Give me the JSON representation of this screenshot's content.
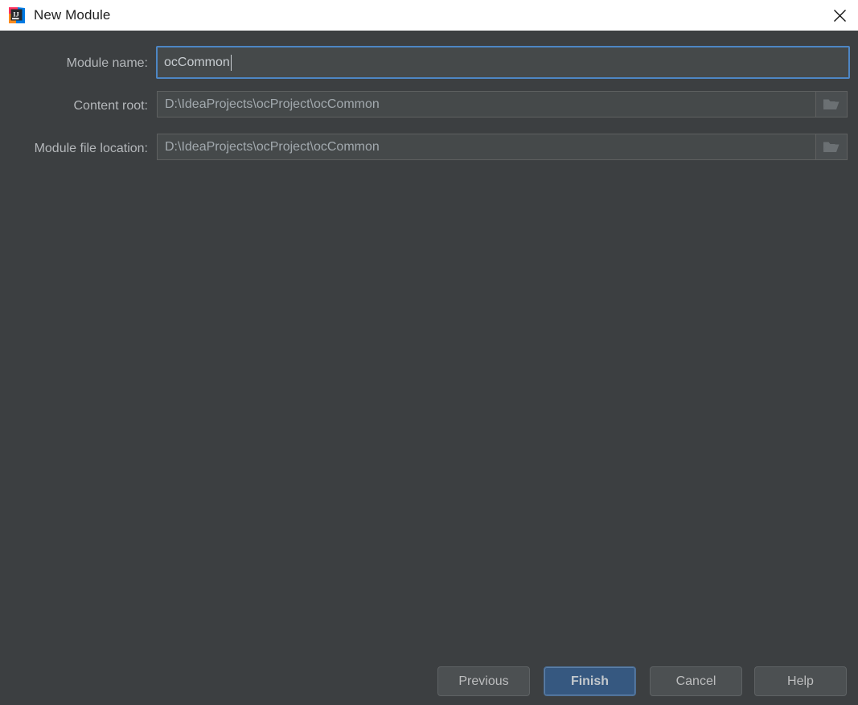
{
  "window": {
    "title": "New Module",
    "logo_icon": "intellij-idea-logo-icon",
    "close_icon": "close-icon"
  },
  "form": {
    "fields": [
      {
        "label": "Module name:",
        "value": "ocCommon",
        "focused": true,
        "has_browse": false
      },
      {
        "label": "Content root:",
        "value": "D:\\IdeaProjects\\ocProject\\ocCommon",
        "focused": false,
        "has_browse": true,
        "browse_icon": "folder-icon"
      },
      {
        "label": "Module file location:",
        "value": "D:\\IdeaProjects\\ocProject\\ocCommon",
        "focused": false,
        "has_browse": true,
        "browse_icon": "folder-icon"
      }
    ]
  },
  "buttons": {
    "previous": "Previous",
    "finish": "Finish",
    "cancel": "Cancel",
    "help": "Help"
  },
  "colors": {
    "dialog_background": "#3c3f41",
    "titlebar_background": "#ffffff",
    "field_background": "#45494a",
    "focus_border": "#4d86c4",
    "default_button": "#365880",
    "label_text": "#b4b7ba"
  }
}
